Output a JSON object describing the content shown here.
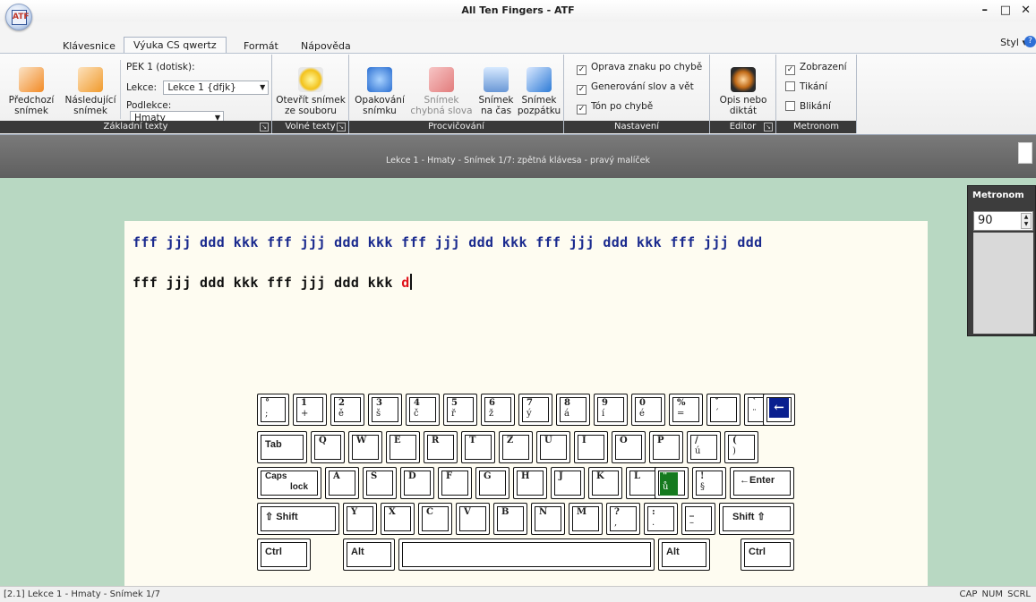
{
  "app": {
    "title": "All Ten Fingers - ATF",
    "logo_text": "ATF"
  },
  "window_controls": {
    "minimize": "–",
    "maximize": "□",
    "close": "✕"
  },
  "menu_tabs": [
    "Klávesnice",
    "Výuka CS qwertz",
    "Formát",
    "Nápověda"
  ],
  "style_menu": "Styl ▾",
  "ribbon": {
    "zakladni": {
      "label": "Základní texty",
      "prev_line1": "Předchozí",
      "prev_line2": "snímek",
      "next_line1": "Následující",
      "next_line2": "snímek",
      "course": "PEK 1 (dotisk):",
      "lesson_label": "Lekce:",
      "lesson_value": "Lekce  1 {dfjk}",
      "sublesson_label": "Podlekce:",
      "sublesson_value": "Hmaty"
    },
    "volne": {
      "label": "Volné texty",
      "open_line1": "Otevřít snímek",
      "open_line2": "ze souboru"
    },
    "procvicovani": {
      "label": "Procvičování",
      "repeat_line1": "Opakování",
      "repeat_line2": "snímku",
      "err_line1": "Snímek",
      "err_line2": "chybná slova",
      "time_line1": "Snímek",
      "time_line2": "na čas",
      "back_line1": "Snímek",
      "back_line2": "pozpátku"
    },
    "nastaveni": {
      "label": "Nastavení",
      "opt1": "Oprava znaku po chybě",
      "opt2": "Generování slov a vět",
      "opt3": "Tón po chybě"
    },
    "editor": {
      "label": "Editor",
      "dict_line1": "Opis nebo",
      "dict_line2": "diktát"
    },
    "metronom": {
      "label": "Metronom",
      "opt1": "Zobrazení",
      "opt2": "Tikání",
      "opt3": "Blikání"
    }
  },
  "info_bar": "Lekce 1 - Hmaty - Snímek 1/7:    zpětná klávesa - pravý malíček",
  "exercise": {
    "target": "fff jjj ddd kkk fff jjj ddd kkk fff jjj ddd kkk fff jjj ddd kkk fff jjj ddd",
    "typed": "fff jjj ddd kkk fff jjj ddd kkk ",
    "typed_error": "d"
  },
  "metronome": {
    "title": "Metronom",
    "value": "90"
  },
  "keyboard": {
    "row1": [
      [
        "°",
        ";"
      ],
      [
        "1",
        "+"
      ],
      [
        "2",
        "ě"
      ],
      [
        "3",
        "š"
      ],
      [
        "4",
        "č"
      ],
      [
        "5",
        "ř"
      ],
      [
        "6",
        "ž"
      ],
      [
        "7",
        "ý"
      ],
      [
        "8",
        "á"
      ],
      [
        "9",
        "í"
      ],
      [
        "0",
        "é"
      ],
      [
        "%",
        "="
      ],
      [
        "ˇ",
        "´"
      ],
      [
        "`",
        "¨"
      ]
    ],
    "backspace": "←",
    "tab": "Tab",
    "row2": [
      "Q",
      "W",
      "E",
      "R",
      "T",
      "Z",
      "U",
      "I",
      "O",
      "P"
    ],
    "row2_extra": [
      [
        "/",
        "ú"
      ],
      [
        "(",
        ")"
      ]
    ],
    "caps_line1": "Caps",
    "caps_line2": "lock",
    "row3": [
      "A",
      "S",
      "D",
      "F",
      "G",
      "H",
      "J",
      "K",
      "L"
    ],
    "row3_extra": [
      [
        "\"",
        "ů"
      ],
      [
        "!",
        "§"
      ]
    ],
    "enter": "←Enter",
    "shift_left": "⇧  Shift",
    "row4": [
      "Y",
      "X",
      "C",
      "V",
      "B",
      "N",
      "M"
    ],
    "row4_extra": [
      [
        "?",
        ","
      ],
      [
        ":",
        "."
      ],
      [
        "_",
        "–"
      ]
    ],
    "shift_right": "Shift  ⇧",
    "ctrl": "Ctrl",
    "alt": "Alt"
  },
  "status": {
    "text": "[2.1]  Lekce 1 - Hmaty - Snímek 1/7",
    "indicators": "CAP NUM SCRL"
  },
  "colors": {
    "workarea": "#b8d8c2",
    "page": "#fefcf1",
    "target_text": "#1a2a8e",
    "error_text": "#e0131b",
    "highlight_key": "#157a1f",
    "backspace_key": "#0a1f8f"
  }
}
